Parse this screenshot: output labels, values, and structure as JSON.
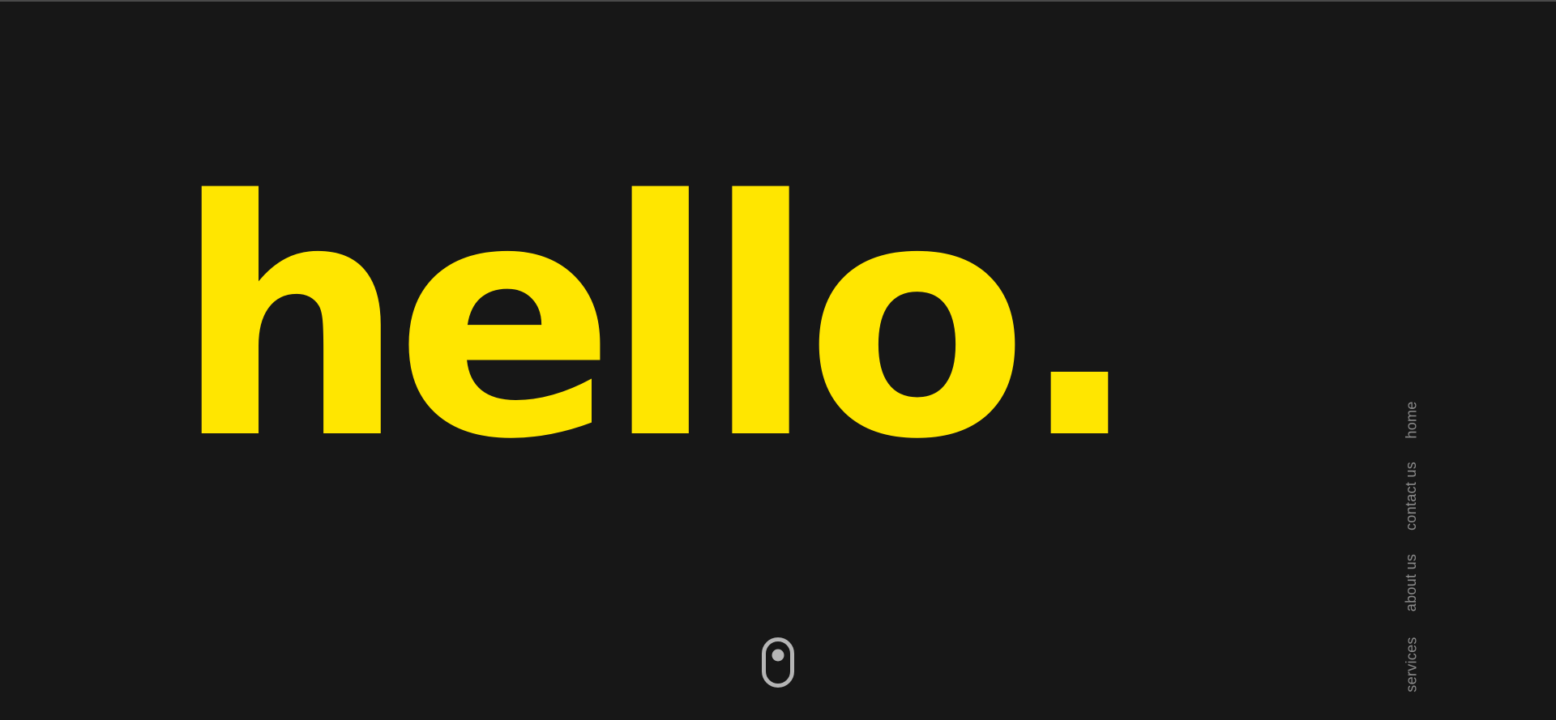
{
  "hero": {
    "title": "hello."
  },
  "nav": {
    "items": [
      {
        "label": "home"
      },
      {
        "label": "contact us"
      },
      {
        "label": "about us"
      },
      {
        "label": "services"
      }
    ]
  },
  "colors": {
    "background": "#171717",
    "accent": "#ffe600",
    "nav_text": "#8a8a8a",
    "scroll_icon": "#b5b5b5"
  },
  "icons": {
    "scroll_indicator": "mouse-scroll-icon"
  }
}
